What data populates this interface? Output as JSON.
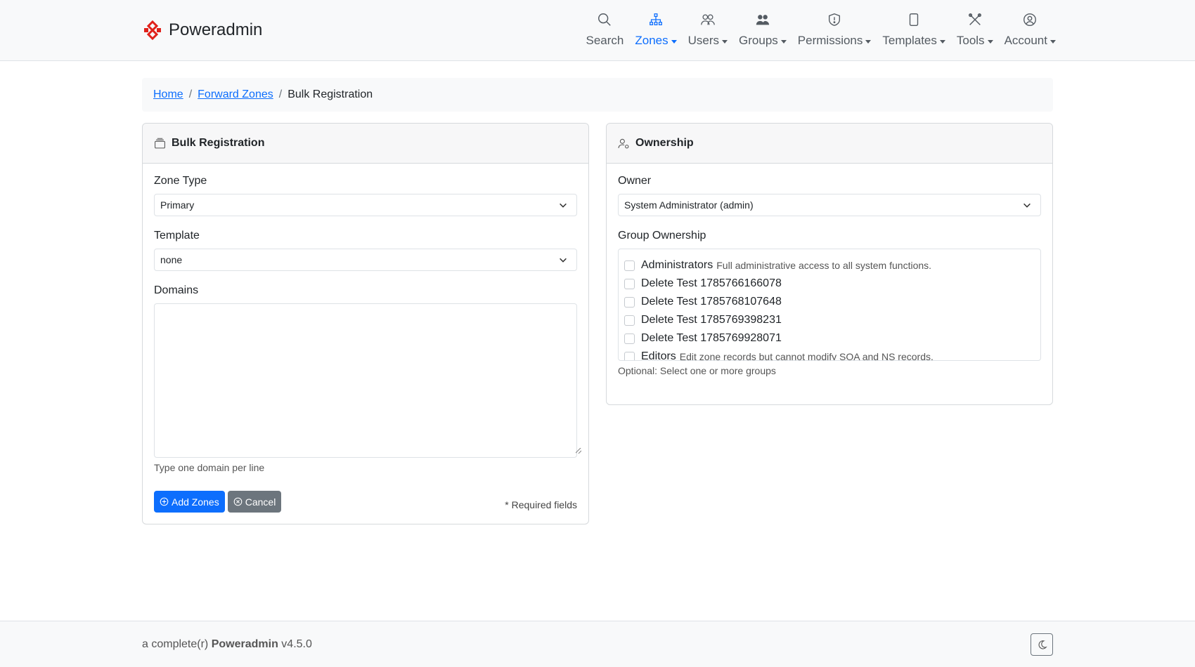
{
  "brand": {
    "name": "Poweradmin",
    "accent": "#e0211a"
  },
  "nav": {
    "items": [
      {
        "label": "Search",
        "icon": "search-icon",
        "dropdown": false,
        "active": false
      },
      {
        "label": "Zones",
        "icon": "sitemap-icon",
        "dropdown": true,
        "active": true
      },
      {
        "label": "Users",
        "icon": "users-icon",
        "dropdown": true,
        "active": false
      },
      {
        "label": "Groups",
        "icon": "group-icon",
        "dropdown": true,
        "active": false
      },
      {
        "label": "Permissions",
        "icon": "shield-icon",
        "dropdown": true,
        "active": false
      },
      {
        "label": "Templates",
        "icon": "copy-icon",
        "dropdown": true,
        "active": false
      },
      {
        "label": "Tools",
        "icon": "tools-icon",
        "dropdown": true,
        "active": false
      },
      {
        "label": "Account",
        "icon": "account-icon",
        "dropdown": true,
        "active": false
      }
    ],
    "active_color": "#0d6efd"
  },
  "breadcrumb": {
    "home": "Home",
    "forward_zones": "Forward Zones",
    "separator": "/",
    "current": "Bulk Registration"
  },
  "bulk": {
    "title": "Bulk Registration",
    "zone_type_label": "Zone Type",
    "zone_type_value": "Primary",
    "template_label": "Template",
    "template_value": "none",
    "domains_label": "Domains",
    "domains_value": "",
    "domains_help": "Type one domain per line",
    "add_button": "Add Zones",
    "cancel_button": "Cancel",
    "required_note": "* Required fields"
  },
  "ownership": {
    "title": "Ownership",
    "owner_label": "Owner",
    "owner_value": "System Administrator (admin)",
    "group_label": "Group Ownership",
    "groups": [
      {
        "name": "Administrators",
        "description": "Full administrative access to all system functions."
      },
      {
        "name": "Delete Test 1785766166078",
        "description": ""
      },
      {
        "name": "Delete Test 1785768107648",
        "description": ""
      },
      {
        "name": "Delete Test 1785769398231",
        "description": ""
      },
      {
        "name": "Delete Test 1785769928071",
        "description": ""
      },
      {
        "name": "Editors",
        "description": "Edit zone records but cannot modify SOA and NS records."
      }
    ],
    "group_help": "Optional: Select one or more groups"
  },
  "footer": {
    "prefix": "a complete(r)",
    "product": "Poweradmin",
    "version": "v4.5.0",
    "theme_icon": "moon-icon"
  }
}
